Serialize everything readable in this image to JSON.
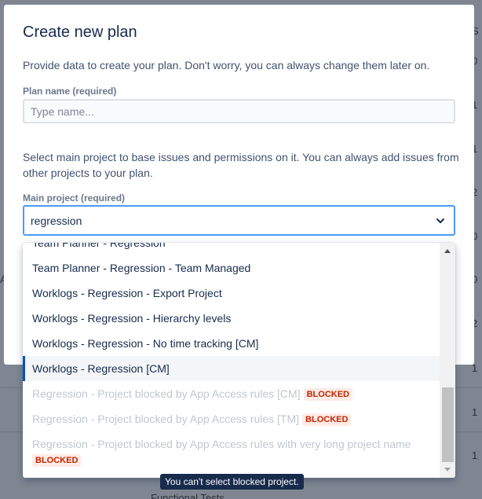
{
  "background": {
    "column_header": "S",
    "column_cells": [
      "0",
      "1",
      "1",
      "2",
      "0",
      "0",
      "2",
      "1",
      "1",
      "1"
    ],
    "left_fragment": "A",
    "bottom_text": "Functional Tests"
  },
  "modal": {
    "title": "Create new plan",
    "intro": "Provide data to create your plan. Don't worry, you can always change them later on.",
    "plan_name_label": "Plan name (required)",
    "plan_name_placeholder": "Type name...",
    "project_description": "Select main project to base issues and permissions on it. You can always add issues from other projects to your plan.",
    "main_project_label": "Main project (required)",
    "main_project_value": "regression"
  },
  "dropdown": {
    "options": [
      {
        "label": "Team Planner - Regression",
        "blocked": false
      },
      {
        "label": "Team Planner - Regression - Team Managed",
        "blocked": false
      },
      {
        "label": "Worklogs - Regression - Export Project",
        "blocked": false
      },
      {
        "label": "Worklogs - Regression - Hierarchy levels",
        "blocked": false
      },
      {
        "label": "Worklogs - Regression - No time tracking [CM]",
        "blocked": false
      },
      {
        "label": "Worklogs - Regression [CM]",
        "blocked": false,
        "selected": true
      },
      {
        "label": "Regression - Project blocked by App Access rules [CM]",
        "blocked": true
      },
      {
        "label": "Regression - Project blocked by App Access rules [TM]",
        "blocked": true
      },
      {
        "label": "Regression - Project blocked by App Access rules with very long project name",
        "blocked": true
      }
    ],
    "blocked_badge": "BLOCKED"
  },
  "tooltip": "You can't select blocked project.",
  "colors": {
    "accent": "#0052cc",
    "focus_border": "#4c9aff",
    "blocked_text": "#bf2600",
    "blocked_bg": "#ffebe6"
  }
}
